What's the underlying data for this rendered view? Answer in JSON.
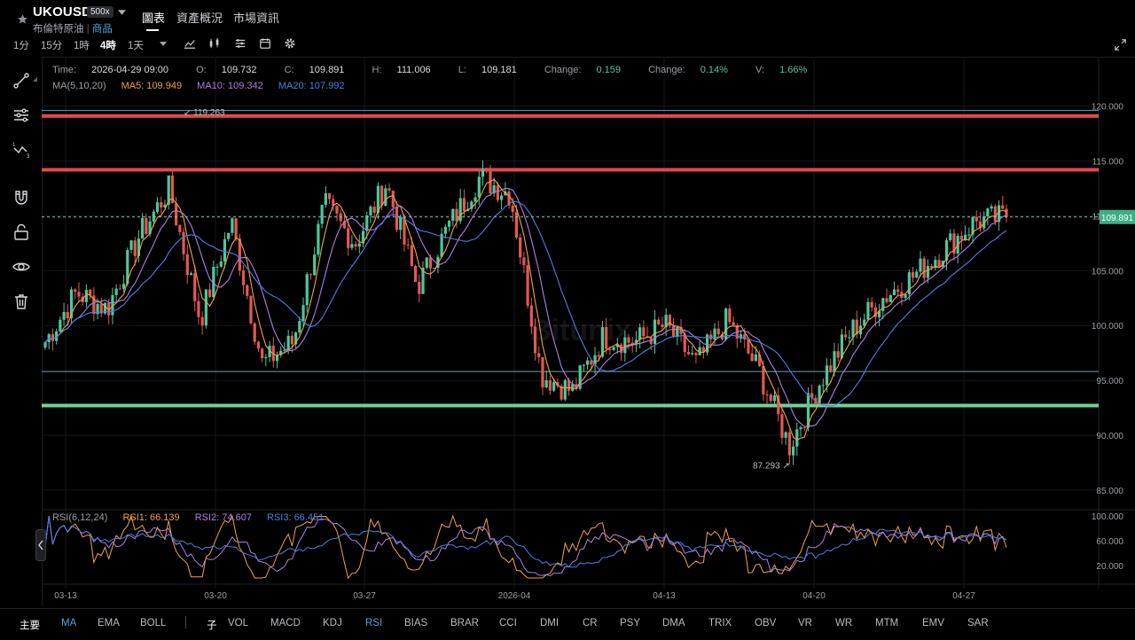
{
  "header": {
    "symbol": "UKOUSD",
    "leverage": "500x",
    "subtitle": "布倫特原油",
    "category": "商品",
    "tabs": [
      {
        "label": "圖表",
        "active": true
      },
      {
        "label": "資產概況",
        "active": false
      },
      {
        "label": "市場資訊",
        "active": false
      }
    ],
    "timeframes": [
      {
        "label": "1分",
        "active": false
      },
      {
        "label": "15分",
        "active": false
      },
      {
        "label": "1時",
        "active": false
      },
      {
        "label": "4時",
        "active": true
      },
      {
        "label": "1天",
        "active": false
      }
    ],
    "toolbar_icons": [
      "chevron-down-icon",
      "indicator-icon",
      "candle-type-icon",
      "settings-sliders-icon",
      "calendar-icon",
      "gear-icon"
    ]
  },
  "sidebar": {
    "tools": [
      "trend-line-icon",
      "settings-sliders-icon",
      "fibonacci-icon",
      "magnet-icon",
      "lock-icon",
      "eye-icon",
      "trash-icon"
    ]
  },
  "info": {
    "time_label": "Time:",
    "time": "2026-04-29 09:00",
    "o_label": "O:",
    "o": "109.732",
    "c_label": "C:",
    "c": "109.891",
    "h_label": "H:",
    "h": "111.006",
    "l_label": "L:",
    "l": "109.181",
    "chg_label": "Change:",
    "chg": "0.159",
    "chgp_label": "Change:",
    "chgp": "0.14%",
    "v_label": "V:",
    "v": "1.66%"
  },
  "ma_legend": {
    "label": "MA(5,10,20)",
    "ma5": "MA5: 109.949",
    "ma10": "MA10: 109.342",
    "ma20": "MA20: 107.992"
  },
  "rsi_legend": {
    "label": "RSI(6,12,24)",
    "rsi1": "RSI1: 66.139",
    "rsi2": "RSI2: 74.607",
    "rsi3": "RSI3: 66.451"
  },
  "watermark": "Bitunix",
  "chart_data": {
    "type": "candlestick",
    "interval": "4時",
    "y_ticks": [
      "120.000",
      "115.000",
      "110.000",
      "105.000",
      "100.000",
      "95.000",
      "90.000",
      "85.000"
    ],
    "ylim": [
      84.5,
      124.5
    ],
    "x_ticks": [
      "03-13",
      "03-20",
      "03-27",
      "2026-04",
      "04-13",
      "04-20",
      "04-27"
    ],
    "current_price": "109.891",
    "high_marker": "119.263",
    "low_marker": "87.293",
    "horizontal_lines": [
      {
        "price": 119.1,
        "color": "#e2494a",
        "kind": "resistance"
      },
      {
        "price": 114.2,
        "color": "#e2494a",
        "kind": "resistance"
      },
      {
        "price": 92.7,
        "color": "#6fd39a",
        "kind": "support"
      },
      {
        "price": 119.6,
        "color": "#5ea5b8",
        "kind": "thin"
      },
      {
        "price": 95.8,
        "color": "#5ea5b8",
        "kind": "thin"
      }
    ],
    "key_closes": [
      98.5,
      103.0,
      101.5,
      108.0,
      112.5,
      100.5,
      109.5,
      96.5,
      98.5,
      111.0,
      107.5,
      113.0,
      103.5,
      109.0,
      113.5,
      112.0,
      95.5,
      94.0,
      99.0,
      98.5,
      100.0,
      96.5,
      100.5,
      96.0,
      89.0,
      95.0,
      99.5,
      102.5,
      104.5,
      107.0,
      109.5,
      109.891
    ],
    "rsi_ticks": [
      "100.000",
      "60.000",
      "20.000"
    ],
    "rsi_range": [
      0,
      100
    ],
    "colors": {
      "up": "#4ec79a",
      "down": "#e2594f",
      "ma5": "#f0a14a",
      "ma10": "#b07ee0",
      "ma20": "#4f7fe3",
      "rsi1": "#f0a14a",
      "rsi2": "#b07ee0",
      "rsi3": "#4f7fe3"
    }
  },
  "bottom": {
    "main_label": "主要",
    "main_inds": [
      {
        "label": "MA",
        "on": true
      },
      {
        "label": "EMA",
        "on": false
      },
      {
        "label": "BOLL",
        "on": false
      }
    ],
    "sub_label": "子",
    "sub_inds": [
      {
        "label": "VOL",
        "on": false
      },
      {
        "label": "MACD",
        "on": false
      },
      {
        "label": "KDJ",
        "on": false
      },
      {
        "label": "RSI",
        "on": true
      },
      {
        "label": "BIAS",
        "on": false
      },
      {
        "label": "BRAR",
        "on": false
      },
      {
        "label": "CCI",
        "on": false
      },
      {
        "label": "DMI",
        "on": false
      },
      {
        "label": "CR",
        "on": false
      },
      {
        "label": "PSY",
        "on": false
      },
      {
        "label": "DMA",
        "on": false
      },
      {
        "label": "TRIX",
        "on": false
      },
      {
        "label": "OBV",
        "on": false
      },
      {
        "label": "VR",
        "on": false
      },
      {
        "label": "WR",
        "on": false
      },
      {
        "label": "MTM",
        "on": false
      },
      {
        "label": "EMV",
        "on": false
      },
      {
        "label": "SAR",
        "on": false
      }
    ]
  }
}
